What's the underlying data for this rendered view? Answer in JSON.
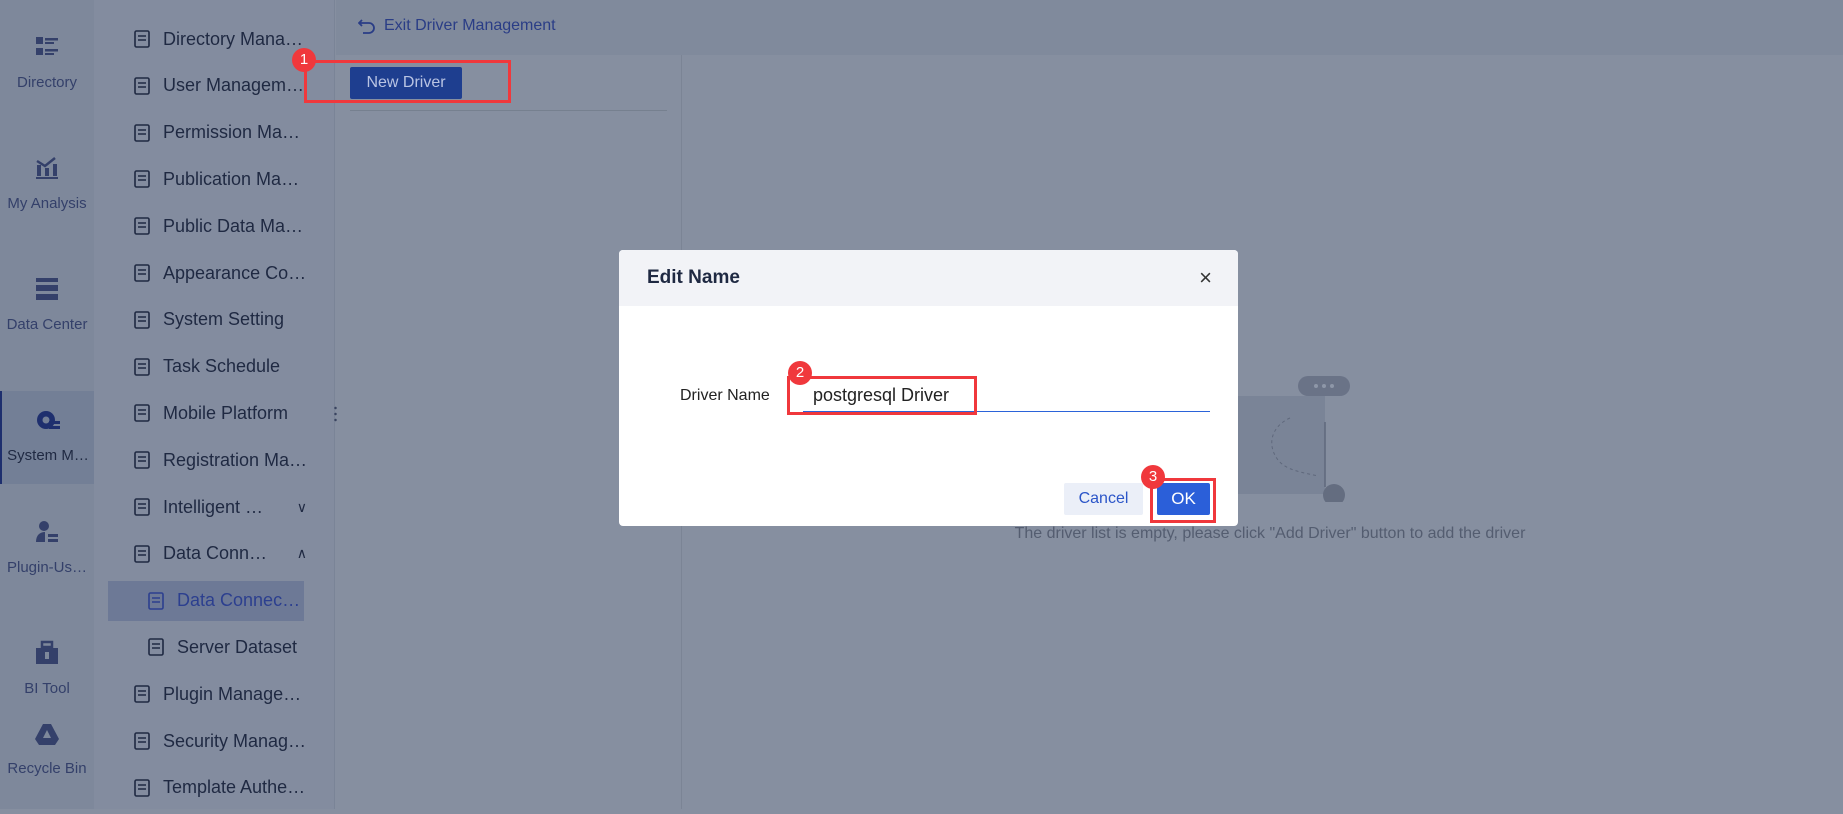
{
  "rail": [
    {
      "label": "Directory",
      "icon": "directory-icon"
    },
    {
      "label": "My Analysis",
      "icon": "analysis-icon"
    },
    {
      "label": "Data Center",
      "icon": "data-center-icon"
    },
    {
      "label": "System M…",
      "icon": "system-gear-icon",
      "active": true
    },
    {
      "label": "Plugin-Us…",
      "icon": "plugin-user-icon"
    },
    {
      "label": "BI Tool",
      "icon": "toolbox-icon"
    },
    {
      "label": "Recycle Bin",
      "icon": "recycle-bin-icon"
    }
  ],
  "sidebar": [
    {
      "label": "Directory Mana…"
    },
    {
      "label": "User Managem…"
    },
    {
      "label": "Permission Ma…"
    },
    {
      "label": "Publication Ma…"
    },
    {
      "label": "Public Data Ma…"
    },
    {
      "label": "Appearance Co…"
    },
    {
      "label": "System Setting"
    },
    {
      "label": "Task Schedule"
    },
    {
      "label": "Mobile Platform"
    },
    {
      "label": "Registration Ma…"
    },
    {
      "label": "Intelligent …",
      "chevron": "∨"
    },
    {
      "label": "Data Conn…",
      "chevron": "∧"
    },
    {
      "label": "Data Connec…"
    },
    {
      "label": "Server Dataset"
    },
    {
      "label": "Plugin Manage…"
    },
    {
      "label": "Security Manag…"
    },
    {
      "label": "Template Authe…"
    }
  ],
  "header": {
    "exit_label": "Exit Driver Management"
  },
  "toolbar": {
    "new_driver": "New Driver"
  },
  "empty_state": "The driver list is empty, please click \"Add Driver\" button to add the driver",
  "dialog": {
    "title": "Edit Name",
    "close": "×",
    "field_label": "Driver Name",
    "field_value": "postgresql Driver",
    "cancel": "Cancel",
    "ok": "OK"
  },
  "annotations": [
    "1",
    "2",
    "3"
  ]
}
